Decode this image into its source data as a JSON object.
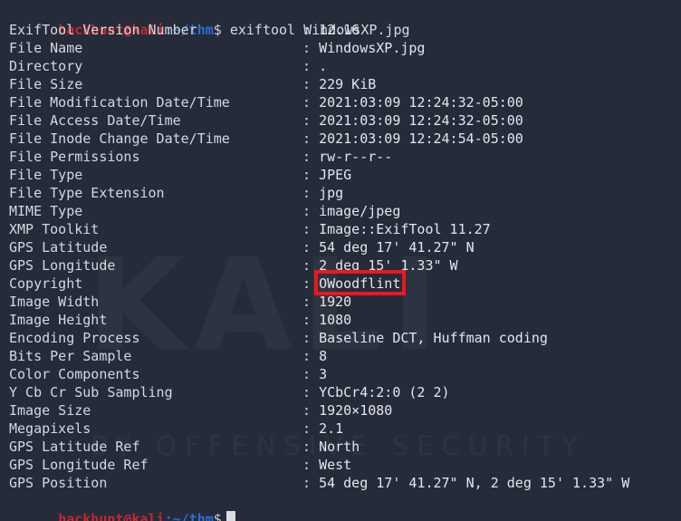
{
  "terminal": {
    "prompt": {
      "user": "hackhunt",
      "at": "@",
      "host": "kali",
      "colon": ":",
      "path": "~/thm",
      "dollar": "$"
    },
    "command": "exiftool WindowsXP.jpg",
    "separator": ":",
    "watermark": {
      "brand": "KALI",
      "tagline": "BY OFFENSIVE SECURITY"
    },
    "highlight": {
      "color": "#e8191f",
      "target_field": "Copyright",
      "target_value": "OWoodflint"
    },
    "rows": [
      {
        "key": "ExifTool Version Number",
        "value": "12.16"
      },
      {
        "key": "File Name",
        "value": "WindowsXP.jpg"
      },
      {
        "key": "Directory",
        "value": "."
      },
      {
        "key": "File Size",
        "value": "229 KiB"
      },
      {
        "key": "File Modification Date/Time",
        "value": "2021:03:09 12:24:32-05:00"
      },
      {
        "key": "File Access Date/Time",
        "value": "2021:03:09 12:24:32-05:00"
      },
      {
        "key": "File Inode Change Date/Time",
        "value": "2021:03:09 12:24:54-05:00"
      },
      {
        "key": "File Permissions",
        "value": "rw-r--r--"
      },
      {
        "key": "File Type",
        "value": "JPEG"
      },
      {
        "key": "File Type Extension",
        "value": "jpg"
      },
      {
        "key": "MIME Type",
        "value": "image/jpeg"
      },
      {
        "key": "XMP Toolkit",
        "value": "Image::ExifTool 11.27"
      },
      {
        "key": "GPS Latitude",
        "value": "54 deg 17' 41.27\" N"
      },
      {
        "key": "GPS Longitude",
        "value": "2 deg 15' 1.33\" W"
      },
      {
        "key": "Copyright",
        "value": "OWoodflint",
        "highlighted": true
      },
      {
        "key": "Image Width",
        "value": "1920"
      },
      {
        "key": "Image Height",
        "value": "1080"
      },
      {
        "key": "Encoding Process",
        "value": "Baseline DCT, Huffman coding"
      },
      {
        "key": "Bits Per Sample",
        "value": "8"
      },
      {
        "key": "Color Components",
        "value": "3"
      },
      {
        "key": "Y Cb Cr Sub Sampling",
        "value": "YCbCr4:2:0 (2 2)"
      },
      {
        "key": "Image Size",
        "value": "1920×1080"
      },
      {
        "key": "Megapixels",
        "value": "2.1"
      },
      {
        "key": "GPS Latitude Ref",
        "value": "North"
      },
      {
        "key": "GPS Longitude Ref",
        "value": "West"
      },
      {
        "key": "GPS Position",
        "value": "54 deg 17' 41.27\" N, 2 deg 15' 1.33\" W"
      }
    ]
  }
}
